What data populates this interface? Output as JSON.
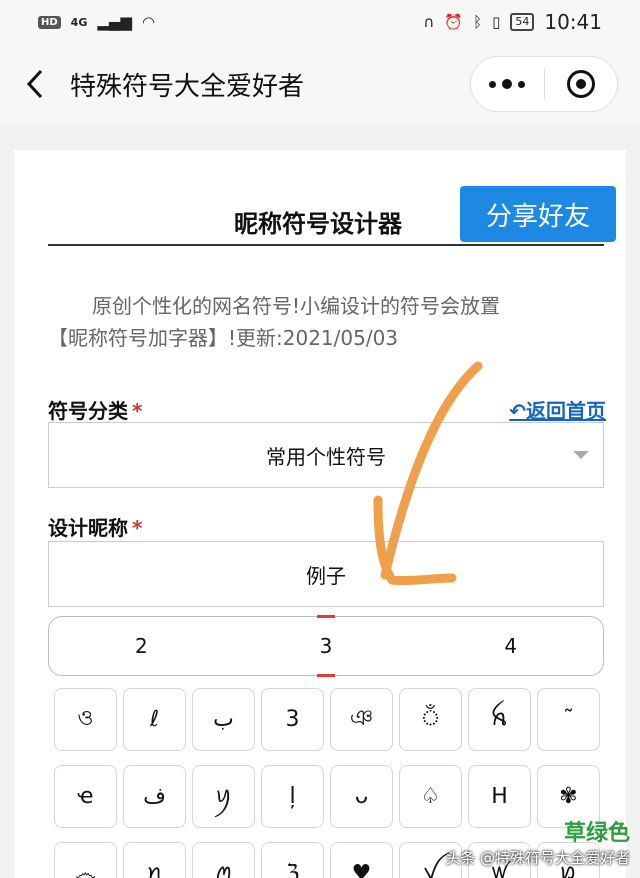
{
  "status_bar": {
    "hd": "HD",
    "network": "4G",
    "battery": "54",
    "time": "10:41"
  },
  "nav": {
    "title": "特殊符号大全爱好者"
  },
  "header": {
    "title": "昵称符号设计器",
    "share_label": "分享好友",
    "accent_color": "#1e88e5"
  },
  "description": {
    "line1": "原创个性化的网名符号!小编设计的符号会放置",
    "line2": "【昵称符号加字器】!更新:2021/05/03"
  },
  "category": {
    "label": "符号分类",
    "required": "*",
    "selected": "常用个性符号",
    "home_link": "↶返回首页"
  },
  "nickname": {
    "label": "设计昵称",
    "required": "*",
    "value": "例子"
  },
  "tabs": [
    {
      "label": "2"
    },
    {
      "label": "3"
    },
    {
      "label": "4"
    }
  ],
  "active_tab": "3",
  "symbols": [
    "ও",
    "ℓ",
    "ب",
    "3",
    "ঞ",
    "ঁ",
    "ꫝ",
    "˜",
    "ҽ",
    "ف",
    "ꪗ",
    "ļ",
    "ᴗ",
    "♤",
    "ᕼ",
    "✾",
    "෴",
    "ꪀ",
    "ꪑ",
    "ℨ",
    "♥",
    "ꪜ",
    "ꪝ",
    "ꪭ"
  ],
  "watermark": {
    "green": "草绿色",
    "text": "头条 @特殊符号大全爱好者"
  }
}
